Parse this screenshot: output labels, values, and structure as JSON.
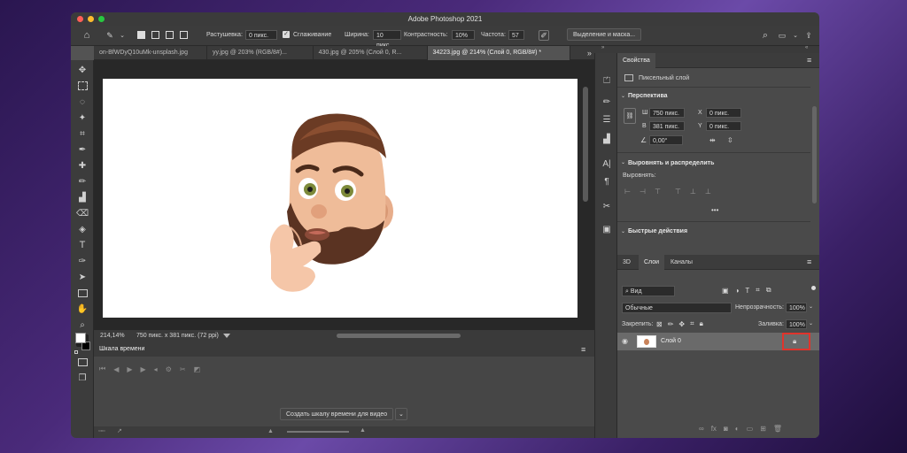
{
  "app": {
    "title": "Adobe Photoshop 2021"
  },
  "options_bar": {
    "feather_label": "Растушевка:",
    "feather_value": "0 пикс.",
    "antialias_label": "Сглаживание",
    "width_label": "Ширина:",
    "width_value": "10 пикс",
    "contrast_label": "Контрастность:",
    "contrast_value": "10%",
    "frequency_label": "Частота:",
    "frequency_value": "57",
    "select_mask_button": "Выделение и маска..."
  },
  "tabs": [
    {
      "label": "on-BfWDyQ10uMk-unsplash.jpg"
    },
    {
      "label": "yy.jpg @ 203% (RGB/8#)..."
    },
    {
      "label": "430.jpg @ 205% (Слой 0, R..."
    },
    {
      "label": "34223.jpg @ 214% (Слой 0, RGB/8#) *"
    }
  ],
  "status": {
    "zoom": "214,14%",
    "doc_info": "750 пикс. x 381 пикс. (72 ppi)"
  },
  "timeline": {
    "title": "Шкала времени",
    "create_button": "Создать шкалу времени для видео"
  },
  "properties": {
    "tab": "Свойства",
    "layer_type": "Пиксельный слой",
    "perspective_title": "Перспектива",
    "w_label": "Ш",
    "w_value": "750 пикс.",
    "h_label": "В",
    "h_value": "381 пикс.",
    "x_label": "X",
    "x_value": "0 пикс.",
    "y_label": "Y",
    "y_value": "0 пикс.",
    "angle_value": "0,00°",
    "align_title": "Выровнять и распределить",
    "align_label": "Выровнять:",
    "more": "•••",
    "quick_actions_title": "Быстрые действия"
  },
  "layers_panel": {
    "tabs": [
      "3D",
      "Слои",
      "Каналы"
    ],
    "kind_filter": "Вид",
    "blend_mode": "Обычные",
    "opacity_label": "Непрозрачность:",
    "opacity_value": "100%",
    "lock_label": "Закрепить:",
    "fill_label": "Заливка:",
    "fill_value": "100%",
    "layer_name": "Слой 0"
  },
  "colors": {
    "highlight": "#e0342c"
  }
}
